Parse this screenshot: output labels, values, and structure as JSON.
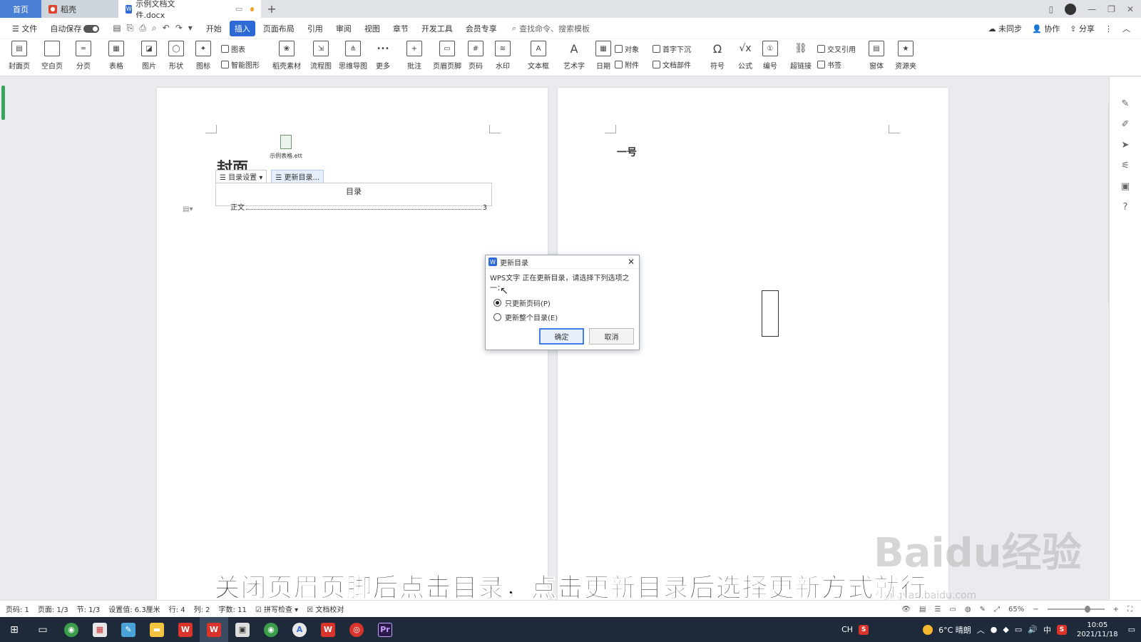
{
  "tabs": {
    "home": "首页",
    "daoke": "稻壳",
    "doc": "示例文档文件.docx"
  },
  "menu": {
    "file": "文件",
    "autosave": "自动保存",
    "items": [
      "开始",
      "插入",
      "页面布局",
      "引用",
      "审阅",
      "视图",
      "章节",
      "开发工具",
      "会员专享"
    ],
    "active_index": 1,
    "search_placeholder": "查找命令、搜索模板",
    "sync": "未同步",
    "collab": "协作",
    "share": "分享"
  },
  "ribbon": {
    "cover": "封面页",
    "blank": "空白页",
    "pagebreak": "分页",
    "table": "表格",
    "picture": "图片",
    "shape": "形状",
    "icon": "图标",
    "chart": "图表",
    "smartart": "智能图形",
    "daoke_material": "稻壳素材",
    "flowchart": "流程图",
    "mindmap": "思维导图",
    "more": "更多",
    "comment": "批注",
    "header_footer": "页眉页脚",
    "page_number": "页码",
    "watermark": "水印",
    "textbox": "文本框",
    "wordart": "艺术字",
    "date": "日期",
    "object": "对象",
    "attachment": "附件",
    "dropcap": "首字下沉",
    "docparts": "文档部件",
    "symbol": "符号",
    "formula": "公式",
    "numbering": "编号",
    "hyperlink": "超链接",
    "crossref": "交叉引用",
    "bookmark": "书签",
    "form": "窗体",
    "resource": "资源夹"
  },
  "document": {
    "attachment_name": "示例表格.ett",
    "cover_text": "封面",
    "toc_settings": "目录设置",
    "toc_update": "更新目录...",
    "toc_title": "目录",
    "toc_entry": "正文",
    "toc_page": "3",
    "page2_heading": "一号"
  },
  "dialog": {
    "title": "更新目录",
    "message": "WPS文字 正在更新目录，请选择下列选项之一：",
    "option1": "只更新页码(P)",
    "option2": "更新整个目录(E)",
    "ok": "确定",
    "cancel": "取消"
  },
  "subtitle": "关闭页眉页脚后点击目录，点击更新目录后选择更新方式就行",
  "watermark": "Baidu经验",
  "watermark_url": "jingyan.baidu.com",
  "status": {
    "page_num": "页码: 1",
    "pages": "页面: 1/3",
    "section": "节: 1/3",
    "setting": "设置值: 6.3厘米",
    "row": "行: 4",
    "col": "列: 2",
    "words": "字数: 11",
    "spell": "拼写检查",
    "proof": "文档校对",
    "zoom": "65%"
  },
  "taskbar": {
    "ime": "CH",
    "weather": "6°C 晴朗",
    "lang": "中",
    "time": "10:05",
    "date": "2021/11/18"
  },
  "colors": {
    "accent": "#2e6ad6",
    "home_tab": "#4a7fd6",
    "taskbar": "#1e2a3a"
  }
}
